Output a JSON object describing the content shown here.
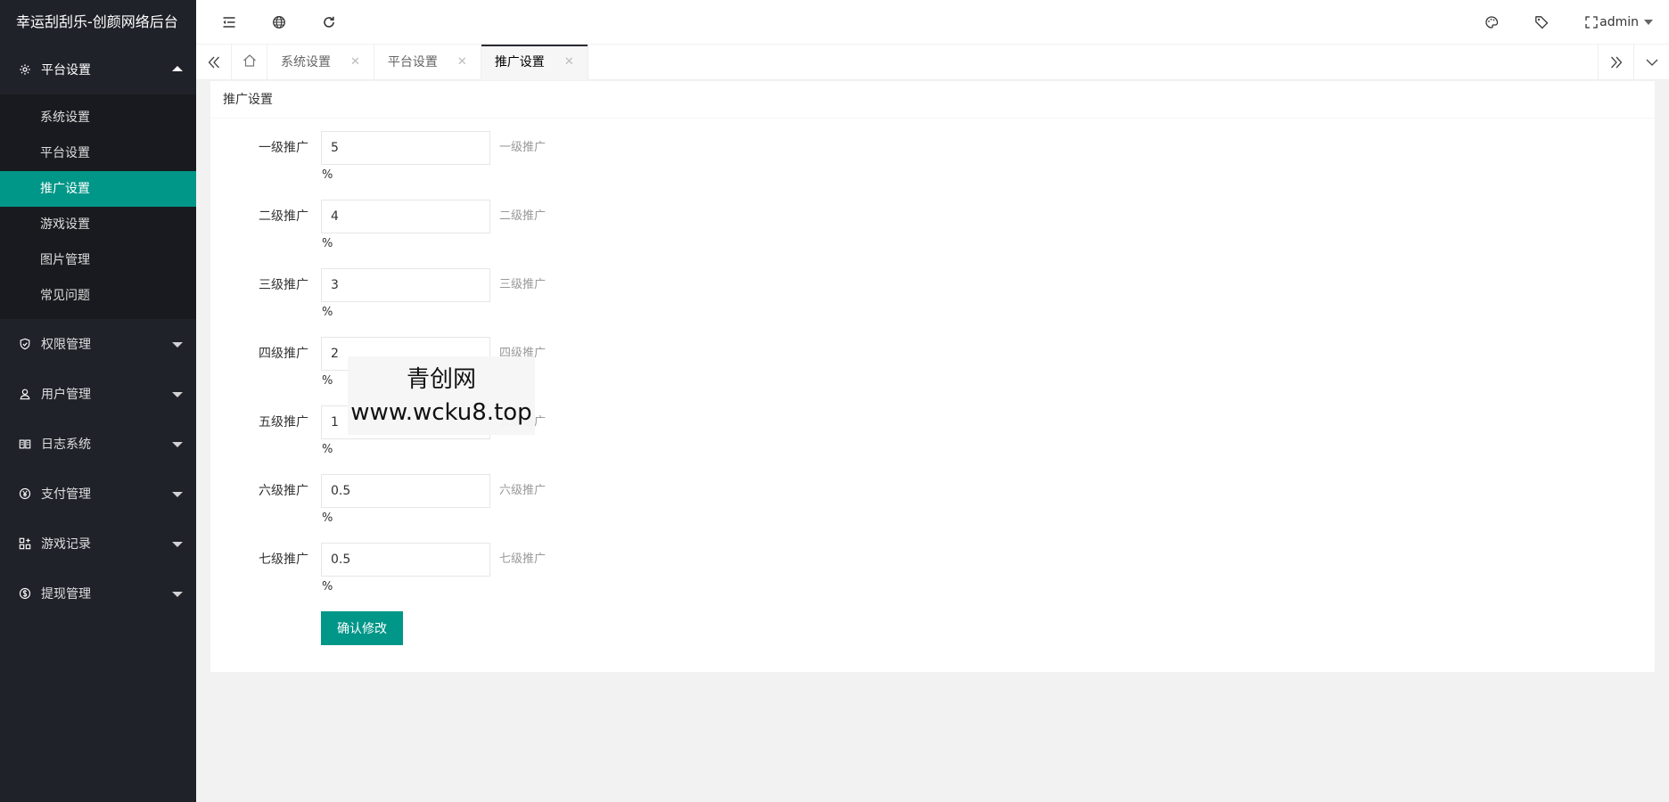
{
  "app": {
    "title": "幸运刮刮乐-创颜网络后台"
  },
  "sidebar": {
    "groups": [
      {
        "label": "平台设置",
        "icon": "gear-icon",
        "open": true,
        "items": [
          {
            "label": "系统设置"
          },
          {
            "label": "平台设置"
          },
          {
            "label": "推广设置",
            "active": true
          },
          {
            "label": "游戏设置"
          },
          {
            "label": "图片管理"
          },
          {
            "label": "常见问题"
          }
        ]
      },
      {
        "label": "权限管理",
        "icon": "shield-icon"
      },
      {
        "label": "用户管理",
        "icon": "user-icon"
      },
      {
        "label": "日志系统",
        "icon": "book-icon"
      },
      {
        "label": "支付管理",
        "icon": "yen-icon"
      },
      {
        "label": "游戏记录",
        "icon": "apps-icon"
      },
      {
        "label": "提现管理",
        "icon": "dollar-icon"
      }
    ]
  },
  "header": {
    "left_icons": [
      "menu-fold-icon",
      "globe-icon",
      "refresh-icon"
    ],
    "right_icons": [
      "theme-icon",
      "tag-icon",
      "fullscreen-icon"
    ],
    "user": "admin"
  },
  "tabs": {
    "items": [
      {
        "label": "系统设置",
        "close": "✕"
      },
      {
        "label": "平台设置",
        "close": "✕"
      },
      {
        "label": "推广设置",
        "close": "✕",
        "active": true
      }
    ]
  },
  "card": {
    "title": "推广设置",
    "fields": [
      {
        "label": "一级推广",
        "value": "5",
        "hint": "一级推广",
        "unit": "%"
      },
      {
        "label": "二级推广",
        "value": "4",
        "hint": "二级推广",
        "unit": "%"
      },
      {
        "label": "三级推广",
        "value": "3",
        "hint": "三级推广",
        "unit": "%"
      },
      {
        "label": "四级推广",
        "value": "2",
        "hint": "四级推广",
        "unit": "%"
      },
      {
        "label": "五级推广",
        "value": "1",
        "hint": "五级推广",
        "unit": "%"
      },
      {
        "label": "六级推广",
        "value": "0.5",
        "hint": "六级推广",
        "unit": "%"
      },
      {
        "label": "七级推广",
        "value": "0.5",
        "hint": "七级推广",
        "unit": "%"
      }
    ],
    "submit_label": "确认修改"
  },
  "watermark": {
    "line1": "青创网",
    "line2": "www.wcku8.top"
  },
  "colors": {
    "sidebar_bg": "#20222a",
    "submenu_bg": "#191a1f",
    "accent": "#009688"
  }
}
